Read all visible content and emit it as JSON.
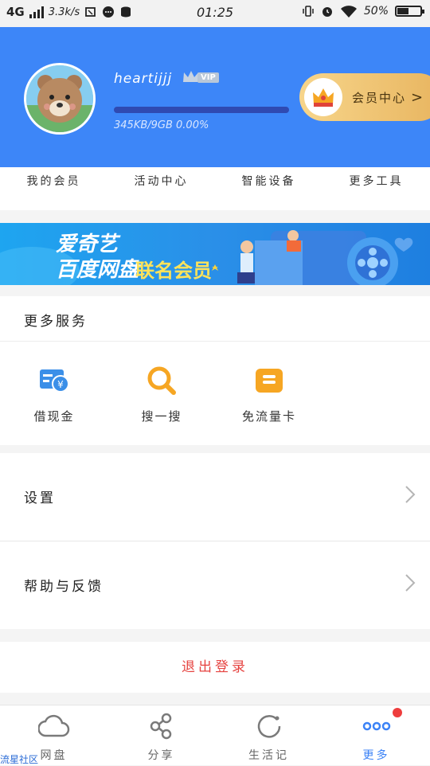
{
  "status_bar": {
    "network": "4G",
    "speed": "3.3k/s",
    "time": "01:25",
    "battery": "50%"
  },
  "profile": {
    "username": "heartijjj",
    "vip_label": "VIP",
    "quota_text": "345KB/9GB 0.00%",
    "usage_fraction": 0.0,
    "member_center_label": "会员中心",
    "member_center_arrow": ">"
  },
  "tabs": [
    "我的会员",
    "活动中心",
    "智能设备",
    "更多工具"
  ],
  "banner": {
    "line1": "爱奇艺",
    "line2": "百度网盘",
    "line3": "联名会员"
  },
  "services": {
    "title": "更多服务",
    "items": [
      {
        "label": "借现金",
        "icon": "cash-card-icon"
      },
      {
        "label": "搜一搜",
        "icon": "search-icon"
      },
      {
        "label": "免流量卡",
        "icon": "sim-card-icon"
      }
    ]
  },
  "menu": {
    "settings_label": "设置",
    "help_label": "帮助与反馈",
    "logout_label": "退出登录"
  },
  "bottom_nav": [
    {
      "label": "网盘",
      "icon": "cloud-icon"
    },
    {
      "label": "分享",
      "icon": "share-icon"
    },
    {
      "label": "生活记",
      "icon": "life-record-icon"
    },
    {
      "label": "更多",
      "icon": "more-dots-icon"
    }
  ],
  "watermark": "流星社区",
  "colors": {
    "header_blue": "#3d86f8",
    "gold": "#e8b560",
    "accent_blue": "#3b82f6",
    "logout_red": "#e64340",
    "badge_red": "#ee3d3d",
    "service_icon_blue": "#3b8fe8",
    "service_icon_orange": "#f6a623"
  }
}
